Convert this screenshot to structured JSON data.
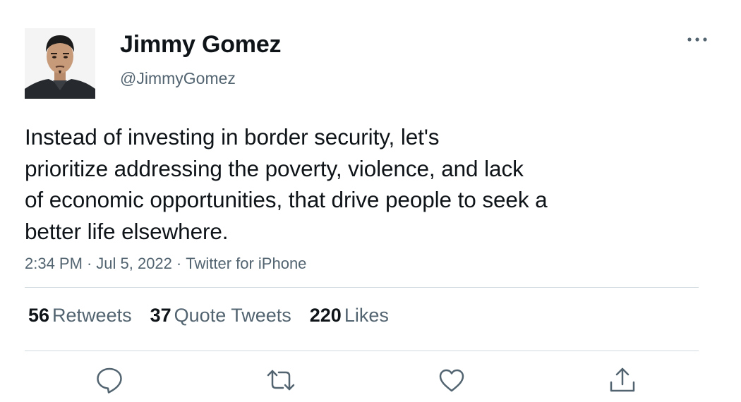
{
  "author": {
    "display_name": "Jimmy Gomez",
    "handle": "@JimmyGomez",
    "avatar_icon": "profile-photo"
  },
  "tweet": {
    "lines": [
      "Instead of investing in border security, let's",
      "prioritize addressing the poverty, violence, and lack",
      "of economic opportunities, that drive people to seek a",
      "better life elsewhere."
    ]
  },
  "meta": {
    "time": "2:34 PM",
    "separator": "·",
    "date": "Jul 5, 2022",
    "source": "Twitter for iPhone"
  },
  "stats": [
    {
      "count": "56",
      "label": "Retweets"
    },
    {
      "count": "37",
      "label": "Quote Tweets"
    },
    {
      "count": "220",
      "label": "Likes"
    }
  ],
  "actions": {
    "reply_icon": "reply-icon",
    "retweet_icon": "retweet-icon",
    "like_icon": "heart-icon",
    "share_icon": "share-icon"
  },
  "colors": {
    "text_primary": "#0f1419",
    "text_secondary": "#536471",
    "divider": "#cfd9de"
  }
}
